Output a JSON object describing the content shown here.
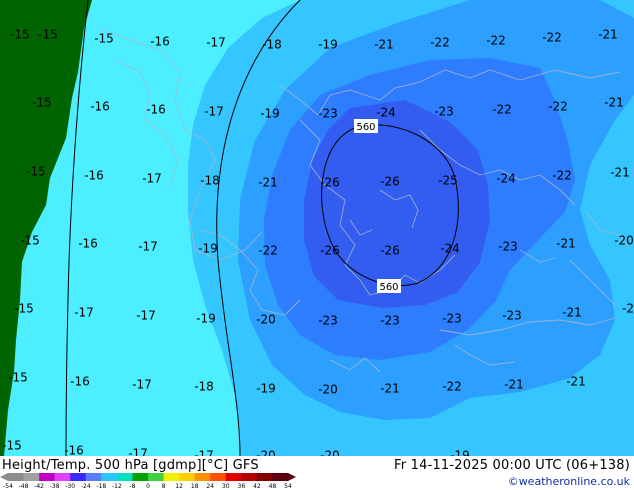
{
  "map": {
    "temperature_labels": [
      {
        "text": "-15",
        "lon": 0.0,
        "lat": 0.0
      },
      {
        "text": "-15",
        "lon": 1,
        "lat": 1
      },
      {
        "text": "-15",
        "lon": 2,
        "lat": 2
      },
      {
        "text": "-16",
        "lon": 3,
        "lat": 3
      },
      {
        "text": "-17",
        "lon": 4,
        "lat": 4
      },
      {
        "text": "-18",
        "lon": 5,
        "lat": 5
      },
      {
        "text": "-19",
        "lon": 6,
        "lat": 6
      },
      {
        "text": "-21",
        "lon": 7,
        "lat": 7
      },
      {
        "text": "-22",
        "lon": 8,
        "lat": 8
      },
      {
        "text": "-22",
        "lon": 9,
        "lat": 9
      },
      {
        "text": "-22",
        "lon": 10,
        "lat": 10
      },
      {
        "text": "-21",
        "lon": 11,
        "lat": 11
      },
      {
        "text": "-15",
        "lon": 12,
        "lat": 12
      },
      {
        "text": "-16",
        "lon": 13,
        "lat": 13
      },
      {
        "text": "-16",
        "lon": 14,
        "lat": 14
      },
      {
        "text": "-17",
        "lon": 15,
        "lat": 15
      },
      {
        "text": "-19",
        "lon": 16,
        "lat": 16
      },
      {
        "text": "-23",
        "lon": 17,
        "lat": 17
      },
      {
        "text": "-24",
        "lon": 18,
        "lat": 18
      },
      {
        "text": "-23",
        "lon": 19,
        "lat": 19
      },
      {
        "text": "-22",
        "lon": 20,
        "lat": 20
      },
      {
        "text": "-22",
        "lon": 21,
        "lat": 21
      },
      {
        "text": "-21",
        "lon": 22,
        "lat": 22
      },
      {
        "text": "-15",
        "lon": 23,
        "lat": 23
      },
      {
        "text": "-16",
        "lon": 24,
        "lat": 24
      },
      {
        "text": "-17",
        "lon": 25,
        "lat": 25
      },
      {
        "text": "-18",
        "lon": 26,
        "lat": 26
      },
      {
        "text": "-21",
        "lon": 27,
        "lat": 27
      },
      {
        "text": "-26",
        "lon": 28,
        "lat": 28
      },
      {
        "text": "-26",
        "lon": 29,
        "lat": 29
      },
      {
        "text": "-25",
        "lon": 30,
        "lat": 30
      },
      {
        "text": "-24",
        "lon": 31,
        "lat": 31
      },
      {
        "text": "-22",
        "lon": 32,
        "lat": 32
      },
      {
        "text": "-21",
        "lon": 33,
        "lat": 33
      },
      {
        "text": "-15",
        "lon": 34,
        "lat": 34
      },
      {
        "text": "-16",
        "lon": 35,
        "lat": 35
      },
      {
        "text": "-17",
        "lon": 36,
        "lat": 36
      },
      {
        "text": "-19",
        "lon": 37,
        "lat": 37
      },
      {
        "text": "-22",
        "lon": 38,
        "lat": 38
      },
      {
        "text": "-26",
        "lon": 39,
        "lat": 39
      },
      {
        "text": "-26",
        "lon": 40,
        "lat": 40
      },
      {
        "text": "-24",
        "lon": 41,
        "lat": 41
      },
      {
        "text": "-23",
        "lon": 42,
        "lat": 42
      },
      {
        "text": "-21",
        "lon": 43,
        "lat": 43
      },
      {
        "text": "-20",
        "lon": 44,
        "lat": 44
      },
      {
        "text": "-15",
        "lon": 45,
        "lat": 45
      },
      {
        "text": "-17",
        "lon": 46,
        "lat": 46
      },
      {
        "text": "-17",
        "lon": 47,
        "lat": 47
      },
      {
        "text": "-19",
        "lon": 48,
        "lat": 48
      },
      {
        "text": "-20",
        "lon": 49,
        "lat": 49
      },
      {
        "text": "-23",
        "lon": 50,
        "lat": 50
      },
      {
        "text": "-23",
        "lon": 51,
        "lat": 51
      },
      {
        "text": "-23",
        "lon": 52,
        "lat": 52
      },
      {
        "text": "-23",
        "lon": 53,
        "lat": 53
      },
      {
        "text": "-21",
        "lon": 54,
        "lat": 54
      },
      {
        "text": "-2",
        "lon": 55,
        "lat": 55
      },
      {
        "text": "-15",
        "lon": 56,
        "lat": 56
      },
      {
        "text": "-16",
        "lon": 57,
        "lat": 57
      },
      {
        "text": "-17",
        "lon": 58,
        "lat": 58
      },
      {
        "text": "-18",
        "lon": 59,
        "lat": 59
      },
      {
        "text": "-19",
        "lon": 60,
        "lat": 60
      },
      {
        "text": "-20",
        "lon": 61,
        "lat": 61
      },
      {
        "text": "-21",
        "lon": 62,
        "lat": 62
      },
      {
        "text": "-22",
        "lon": 63,
        "lat": 63
      },
      {
        "text": "-21",
        "lon": 64,
        "lat": 64
      },
      {
        "text": "-21",
        "lon": 65,
        "lat": 65
      },
      {
        "text": "-15",
        "lon": 66,
        "lat": 66
      },
      {
        "text": "-16",
        "lon": 67,
        "lat": 67
      },
      {
        "text": "-17",
        "lon": 68,
        "lat": 68
      },
      {
        "text": "-17",
        "lon": 69,
        "lat": 69
      },
      {
        "text": "-20",
        "lon": 70,
        "lat": 70
      },
      {
        "text": "-20",
        "lon": 71,
        "lat": 71
      },
      {
        "text": "-19",
        "lon": 72,
        "lat": 72
      }
    ],
    "contour_labels": [
      {
        "text": "560",
        "lon": 100,
        "lat": 100
      },
      {
        "text": "560",
        "lon": 101,
        "lat": 101
      }
    ],
    "zone_colors": {
      "green": "#006400",
      "cyan": "#4deeff",
      "sky": "#35c6ff",
      "blue1": "#2c9fff",
      "blue2": "#2f7dff",
      "blue3": "#335cf0",
      "land_outline": "#a8b8c8"
    }
  },
  "footer": {
    "title": "Height/Temp. 500 hPa [gdmp][°C] GFS",
    "time": "Fr 14-11-2025 00:00 UTC (06+138)",
    "credit": "©weatheronline.co.uk",
    "colorbar": {
      "ticks": [
        "-54",
        "-48",
        "-42",
        "-38",
        "-30",
        "-24",
        "-18",
        "-12",
        "-8",
        "0",
        "8",
        "12",
        "18",
        "24",
        "30",
        "36",
        "42",
        "48",
        "54"
      ],
      "colors": [
        "#8c8c8c",
        "#a0a0a0",
        "#c000c0",
        "#e040ff",
        "#3a2aff",
        "#5a7dff",
        "#28c8ff",
        "#00e0c0",
        "#00a000",
        "#40d040",
        "#f0f000",
        "#ffd000",
        "#ff9000",
        "#ff5000",
        "#e00000",
        "#b00000",
        "#800000",
        "#5a0010"
      ]
    }
  }
}
